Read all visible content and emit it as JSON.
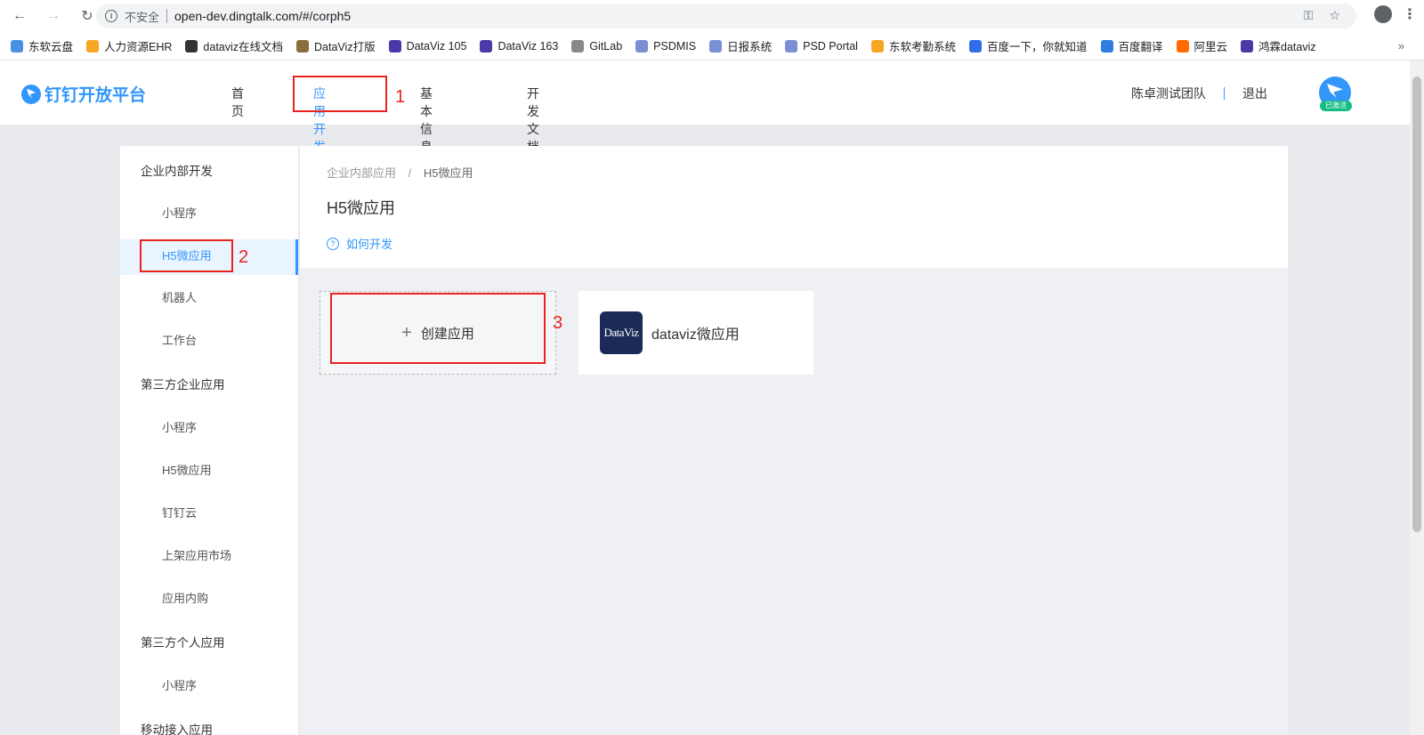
{
  "browser": {
    "insecure_label": "不安全",
    "url": "open-dev.dingtalk.com/#/corph5",
    "back_icon": "←",
    "forward_icon": "→",
    "reload_icon": "↻",
    "key_icon": "⚿",
    "star_icon": "☆",
    "menu_icon": "⋮",
    "bookmarks": [
      {
        "label": "东软云盘",
        "color": "#4a90e2"
      },
      {
        "label": "人力资源EHR",
        "color": "#f5a623"
      },
      {
        "label": "dataviz在线文档",
        "color": "#333333"
      },
      {
        "label": "DataViz打版",
        "color": "#8a6d3b"
      },
      {
        "label": "DataViz 105",
        "color": "#4a3aa8"
      },
      {
        "label": "DataViz 163",
        "color": "#4a3aa8"
      },
      {
        "label": "GitLab",
        "color": "#888888"
      },
      {
        "label": "PSDMIS",
        "color": "#7b8fd4"
      },
      {
        "label": "日报系统",
        "color": "#7b8fd4"
      },
      {
        "label": "PSD Portal",
        "color": "#7b8fd4"
      },
      {
        "label": "东软考勤系统",
        "color": "#f5a623"
      },
      {
        "label": "百度一下，你就知道",
        "color": "#2f6ee6"
      },
      {
        "label": "百度翻译",
        "color": "#2f7de1"
      },
      {
        "label": "阿里云",
        "color": "#ff6a00"
      },
      {
        "label": "鸿霖dataviz",
        "color": "#4a3aa8"
      }
    ],
    "more_label": "»"
  },
  "header": {
    "logo_text": "钉钉开放平台",
    "nav": [
      "首页",
      "应用开发",
      "基本信息",
      "开发文档"
    ],
    "team": "陈卓测试团队",
    "logout": "退出",
    "avatar_badge": "已激活"
  },
  "sidebar": {
    "groups": [
      {
        "title": "企业内部开发",
        "items": [
          "小程序",
          "H5微应用",
          "机器人",
          "工作台"
        ]
      },
      {
        "title": "第三方企业应用",
        "items": [
          "小程序",
          "H5微应用",
          "钉钉云",
          "上架应用市场",
          "应用内购"
        ]
      },
      {
        "title": "第三方个人应用",
        "items": [
          "小程序"
        ]
      },
      {
        "title": "移动接入应用",
        "items": []
      }
    ]
  },
  "main": {
    "breadcrumb": [
      "企业内部应用",
      "H5微应用"
    ],
    "breadcrumb_sep": "/",
    "title": "H5微应用",
    "help_link": "如何开发",
    "create_label": "创建应用",
    "apps": [
      {
        "name": "dataviz微应用",
        "logo_text": "DataViz"
      }
    ]
  },
  "annotations": [
    "1",
    "2",
    "3"
  ]
}
